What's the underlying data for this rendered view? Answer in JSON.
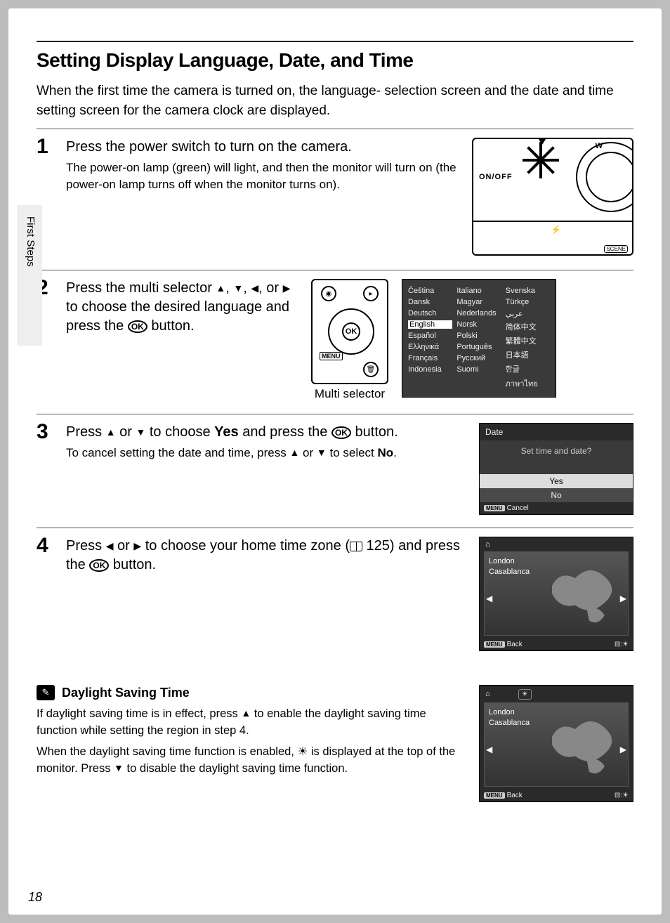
{
  "page": {
    "title": "Setting Display Language, Date, and Time",
    "intro": "When the first time the camera is turned on, the language- selection screen and the date and time setting screen for the camera clock are displayed.",
    "side_tab": "First Steps",
    "page_number": "18"
  },
  "steps": {
    "s1": {
      "num": "1",
      "title": "Press the power switch to turn on the camera.",
      "sub": "The power-on lamp (green) will light, and then the monitor will turn on (the power-on lamp turns off when the monitor turns on).",
      "onoff": "ON/OFF",
      "w": "W",
      "scene": "SCENE"
    },
    "s2": {
      "num": "2",
      "t_a": "Press the multi selector ",
      "t_b": ", ",
      "t_c": ", ",
      "t_d": ", or ",
      "t_e": " to choose the desired language and press the ",
      "t_f": " button.",
      "ok": "OK",
      "dpad": "OK",
      "menu": "MENU",
      "caption": "Multi selector"
    },
    "s3": {
      "num": "3",
      "t_a": "Press ",
      "t_b": " or ",
      "t_c": " to choose ",
      "yes": "Yes",
      "t_d": " and press the ",
      "t_e": " button.",
      "sub_a": "To cancel setting the date and time, press ",
      "sub_b": " or ",
      "sub_c": " to select ",
      "no": "No",
      "sub_d": ".",
      "ok": "OK"
    },
    "s4": {
      "num": "4",
      "t_a": "Press ",
      "t_b": " or ",
      "t_c": " to choose your home time zone (",
      "pg": " 125) and press the ",
      "t_d": " button.",
      "ok": "OK"
    }
  },
  "lcd": {
    "lang": {
      "col1": [
        "Čeština",
        "Dansk",
        "Deutsch",
        "English",
        "Español",
        "Ελληνικά",
        "Français",
        "Indonesia"
      ],
      "col2": [
        "Italiano",
        "Magyar",
        "Nederlands",
        "Norsk",
        "Polski",
        "Português",
        "Русский",
        "Suomi"
      ],
      "col3": [
        "Svenska",
        "Türkçe",
        "عربي",
        "简体中文",
        "繁體中文",
        "日本語",
        "한글",
        "ภาษาไทย"
      ],
      "selected": "English"
    },
    "date": {
      "header": "Date",
      "question": "Set time and date?",
      "yes": "Yes",
      "no": "No",
      "cancel": "Cancel",
      "menu": "MENU"
    },
    "map": {
      "home": "⌂",
      "city1": "London",
      "city2": "Casablanca",
      "back": "Back",
      "menu": "MENU",
      "dst_icon": "☀"
    }
  },
  "note": {
    "title": "Daylight Saving Time",
    "p1_a": "If daylight saving time is in effect, press ",
    "p1_b": " to enable the daylight saving time function while setting the region in step 4.",
    "p2_a": "When the daylight saving time function is enabled, ",
    "p2_b": " is displayed at the top of the monitor. Press ",
    "p2_c": " to disable the daylight saving time function."
  }
}
